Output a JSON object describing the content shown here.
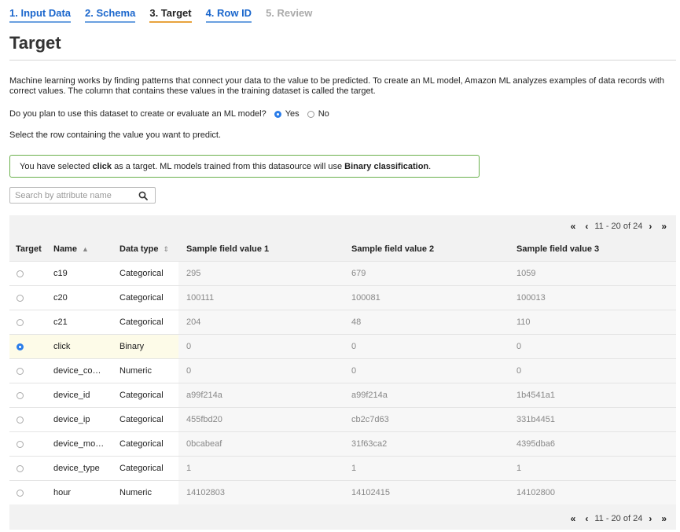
{
  "wizard": {
    "steps": [
      "1. Input Data",
      "2. Schema",
      "3. Target",
      "4. Row ID",
      "5. Review"
    ]
  },
  "page": {
    "title": "Target",
    "intro": "Machine learning works by finding patterns that connect your data to the value to be predicted. To create an ML model, Amazon ML analyzes examples of data records with correct values. The column that contains these values in the training dataset is called the target.",
    "question": "Do you plan to use this dataset to create or evaluate an ML model?",
    "yes_label": "Yes",
    "no_label": "No",
    "selected_option": "Yes",
    "instruction": "Select the row containing the value you want to predict."
  },
  "info": {
    "prefix": "You have selected ",
    "target_name": "click",
    "middle": " as a target. ML models trained from this datasource will use ",
    "model_type": "Binary classification",
    "suffix": "."
  },
  "search": {
    "placeholder": "Search by attribute name",
    "value": ""
  },
  "pagination": {
    "first": "«",
    "prev": "‹",
    "range": "11 - 20 of 24",
    "next": "›",
    "last": "»"
  },
  "table": {
    "headers": {
      "target": "Target",
      "name": "Name",
      "name_sort": "▲",
      "type": "Data type",
      "type_sort": "⇕",
      "s1": "Sample field value 1",
      "s2": "Sample field value 2",
      "s3": "Sample field value 3"
    },
    "rows": [
      {
        "name": "c19",
        "type": "Categorical",
        "s1": "295",
        "s2": "679",
        "s3": "1059",
        "selected": false
      },
      {
        "name": "c20",
        "type": "Categorical",
        "s1": "100111",
        "s2": "100081",
        "s3": "100013",
        "selected": false
      },
      {
        "name": "c21",
        "type": "Categorical",
        "s1": "204",
        "s2": "48",
        "s3": "110",
        "selected": false
      },
      {
        "name": "click",
        "type": "Binary",
        "s1": "0",
        "s2": "0",
        "s3": "0",
        "selected": true
      },
      {
        "name": "device_co…",
        "type": "Numeric",
        "s1": "0",
        "s2": "0",
        "s3": "0",
        "selected": false
      },
      {
        "name": "device_id",
        "type": "Categorical",
        "s1": "a99f214a",
        "s2": "a99f214a",
        "s3": "1b4541a1",
        "selected": false
      },
      {
        "name": "device_ip",
        "type": "Categorical",
        "s1": "455fbd20",
        "s2": "cb2c7d63",
        "s3": "331b4451",
        "selected": false
      },
      {
        "name": "device_mo…",
        "type": "Categorical",
        "s1": "0bcabeaf",
        "s2": "31f63ca2",
        "s3": "4395dba6",
        "selected": false
      },
      {
        "name": "device_type",
        "type": "Categorical",
        "s1": "1",
        "s2": "1",
        "s3": "1",
        "selected": false
      },
      {
        "name": "hour",
        "type": "Numeric",
        "s1": "14102803",
        "s2": "14102415",
        "s3": "14102800",
        "selected": false
      }
    ]
  },
  "colors": {
    "link": "#1a66cc",
    "active_underline": "#e8a33d",
    "info_border": "#6ab04c",
    "radio_selected": "#2b7de9"
  }
}
